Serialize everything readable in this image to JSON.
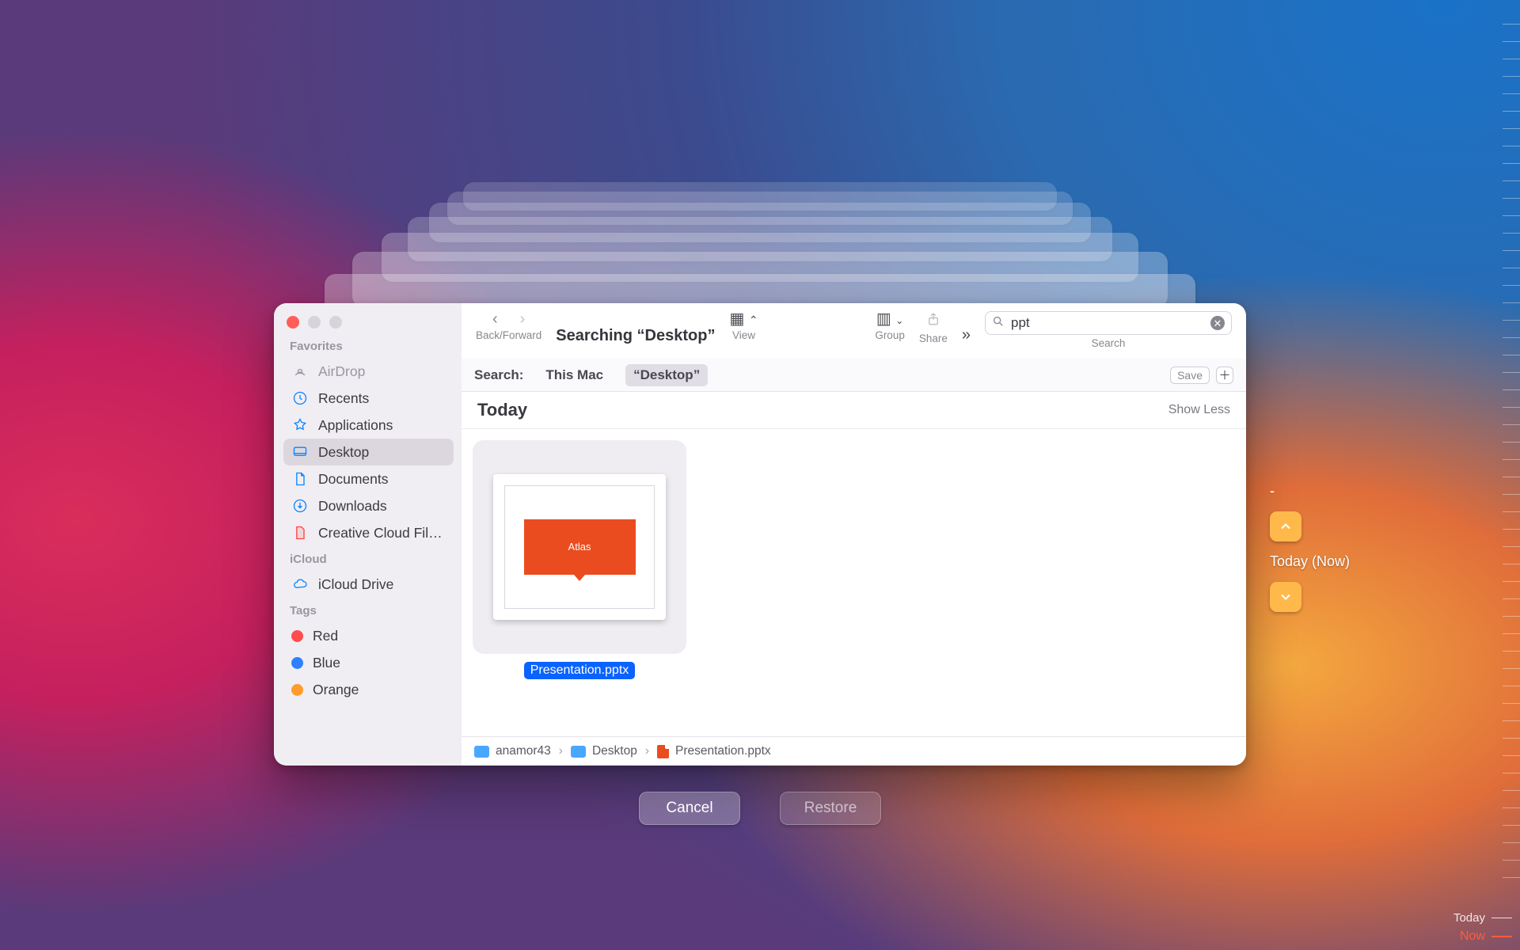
{
  "timemachine": {
    "now_label": "Today (Now)",
    "cancel_label": "Cancel",
    "restore_label": "Restore",
    "timeline_today": "Today",
    "timeline_now": "Now"
  },
  "sidebar": {
    "favorites_label": "Favorites",
    "icloud_label": "iCloud",
    "tags_label": "Tags",
    "favorites": [
      {
        "label": "AirDrop"
      },
      {
        "label": "Recents"
      },
      {
        "label": "Applications"
      },
      {
        "label": "Desktop"
      },
      {
        "label": "Documents"
      },
      {
        "label": "Downloads"
      },
      {
        "label": "Creative Cloud Fil…"
      }
    ],
    "icloud": [
      {
        "label": "iCloud Drive"
      }
    ],
    "tags": [
      {
        "label": "Red",
        "color": "#ff4d4d"
      },
      {
        "label": "Blue",
        "color": "#2f80ff"
      },
      {
        "label": "Orange",
        "color": "#ff9c2d"
      }
    ]
  },
  "toolbar": {
    "title": "Searching “Desktop”",
    "back_forward_label": "Back/Forward",
    "view_label": "View",
    "group_label": "Group",
    "share_label": "Share",
    "search_value": "ppt",
    "search_caption": "Search"
  },
  "scopebar": {
    "search_label": "Search:",
    "this_mac_label": "This Mac",
    "scope_label": "“Desktop”",
    "save_label": "Save"
  },
  "results": {
    "section_label": "Today",
    "show_less_label": "Show Less",
    "file_name": "Presentation.pptx",
    "slide_title": "Atlas"
  },
  "pathbar": {
    "seg1": "anamor43",
    "seg2": "Desktop",
    "seg3": "Presentation.pptx"
  }
}
